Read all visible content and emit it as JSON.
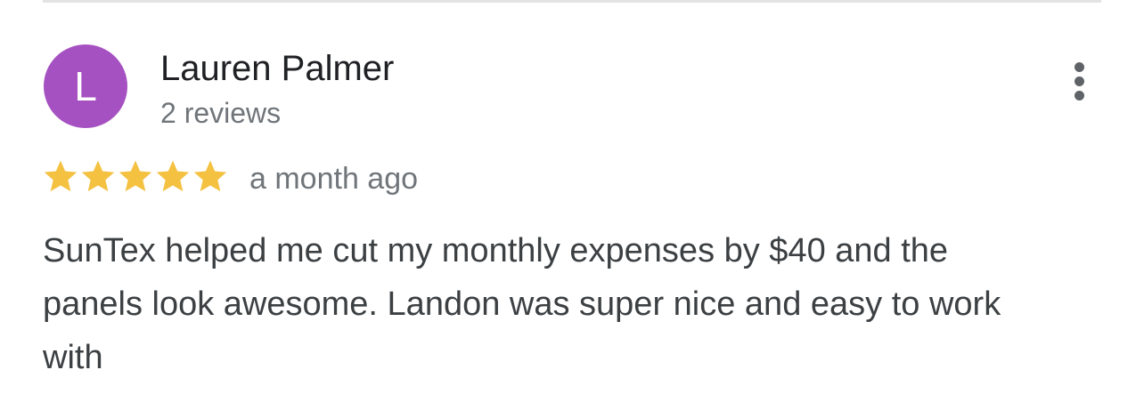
{
  "review": {
    "author": {
      "initial": "L",
      "name": "Lauren Palmer",
      "review_count": "2 reviews",
      "avatar_color": "#a651c1"
    },
    "rating": 5,
    "rating_max": 5,
    "star_color": "#f4c141",
    "date": "a month ago",
    "text": "SunTex helped me cut my monthly expenses by $40 and the panels look awesome. Landon was super nice and easy to work with",
    "menu_icon": "more-vert-icon"
  }
}
